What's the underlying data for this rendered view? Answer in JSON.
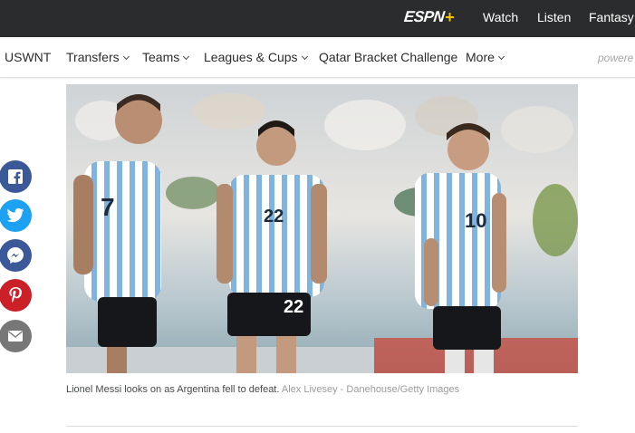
{
  "header": {
    "logo": "ESPN",
    "logo_plus": "+",
    "links": [
      "Watch",
      "Listen",
      "Fantasy"
    ]
  },
  "nav": {
    "items": [
      {
        "label": "USWNT",
        "dropdown": false
      },
      {
        "label": "Transfers",
        "dropdown": true
      },
      {
        "label": "Teams",
        "dropdown": true
      },
      {
        "label": "Leagues & Cups",
        "dropdown": true
      },
      {
        "label": "Qatar Bracket Challenge",
        "dropdown": false
      },
      {
        "label": "More",
        "dropdown": true
      }
    ],
    "powered": "powere"
  },
  "article": {
    "caption": "Lionel Messi looks on as Argentina fell to defeat.",
    "credit": "Alex Livesey - Danehouse/Getty Images",
    "jerseys": [
      "7",
      "22",
      "22",
      "10"
    ]
  },
  "share": [
    {
      "name": "facebook-icon",
      "color": "#3b5998"
    },
    {
      "name": "twitter-icon",
      "color": "#1da1f2"
    },
    {
      "name": "messenger-icon",
      "color": "#3b5998"
    },
    {
      "name": "pinterest-icon",
      "color": "#cb2027"
    },
    {
      "name": "email-icon",
      "color": "#777777"
    }
  ]
}
